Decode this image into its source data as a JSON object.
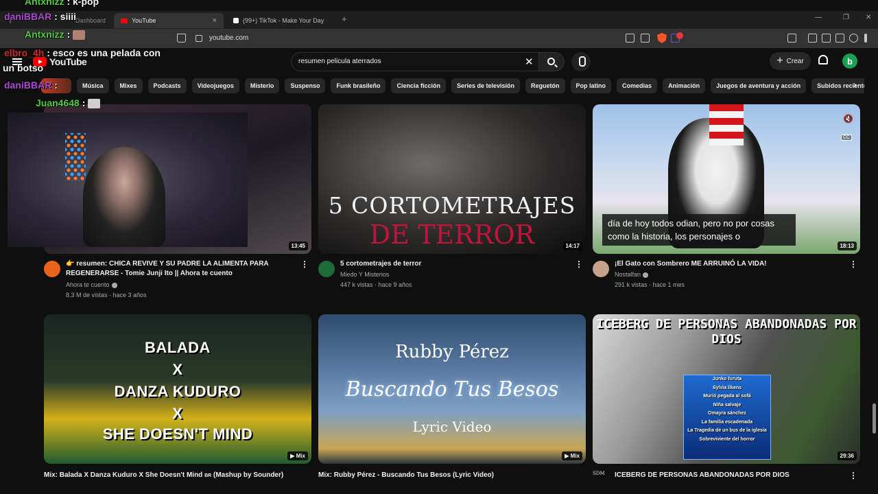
{
  "browser": {
    "tabs": [
      {
        "label": "Dashboard",
        "active": false
      },
      {
        "label": "YouTube",
        "active": true
      },
      {
        "label": "(99+) TikTok - Make Your Day",
        "active": false
      }
    ],
    "new_tab": "+",
    "url": "youtube.com"
  },
  "youtube": {
    "logo": "YouTube",
    "search_query": "resumen pelicula aterrados",
    "create_label": "Crear",
    "avatar_letter": "b",
    "chips": [
      "Música",
      "Mixes",
      "Podcasts",
      "Videojuegos",
      "Misterio",
      "Suspenso",
      "Funk brasileño",
      "Ciencia ficción",
      "Series de televisión",
      "Reguetón",
      "Pop latino",
      "Comedias",
      "Animación",
      "Juegos de aventura y acción",
      "Subidos recientemente"
    ]
  },
  "videos": [
    {
      "title_l1": "👉 resumen: CHICA REVIVE Y SU PADRE LA ALIMENTA PARA",
      "title_l2": "REGENERARSE - Tomie Junji Ito || Ahora te cuento",
      "channel": "Ahora te cuento",
      "stats": "8.3 M de vistas · hace 3 años",
      "duration": "13:45"
    },
    {
      "title_l1": "5 cortometrajes de terror",
      "channel": "Miedo Y Misterios",
      "stats": "447 k vistas · hace 9 años",
      "duration": "14:17",
      "thumb_line1": "5 CORTOMETRAJES",
      "thumb_line2": "DE TERROR"
    },
    {
      "title_l1": "¡El Gato con Sombrero ME ARRUINÓ LA VIDA!",
      "channel": "Nostalfan",
      "stats": "291 k vistas · hace 1 mes",
      "duration": "18:13",
      "caption": "día de hoy todos odian, pero no por cosas como la historia, los personajes o",
      "cc": "CC"
    },
    {
      "title_l1": "Mix: Balada X Danza Kuduro X She Doesn't Mind",
      "title_suffix": "BR",
      "title_l1b": "(Mashup by Sounder)",
      "badge": "Mix",
      "thumb_lines": [
        "BALADA",
        "X",
        "DANZA KUDURO",
        "X",
        "SHE DOESN'T MIND"
      ]
    },
    {
      "title_l1": "Mix: Rubby Pérez - Buscando Tus Besos (Lyric Video)",
      "badge": "Mix",
      "thumb_name": "Rubby Pérez",
      "thumb_song": "Buscando Tus Besos",
      "thumb_lyric": "Lyric Video"
    },
    {
      "title_l1": "ICEBERG DE PERSONAS ABANDONADAS POR DIOS",
      "duration": "29:36",
      "channel_icon_text": "SDM",
      "thumb_head": "ICEBERG DE PERSONAS ABANDONADAS POR DIOS",
      "iceberg_items": [
        "Junko furuta",
        "Sylvia likens",
        "Murió pegada al sofá",
        "Niña salvaje",
        "Omayra sánchez",
        "La familia escadenada",
        "La Tragedia de un bus de la iglesia",
        "Sobreviviente del horror"
      ]
    }
  ],
  "overlay_chat": [
    {
      "user": "Antxnizz",
      "msg": ": k-pop",
      "color": "#4fd13b"
    },
    {
      "user": "daniBBAR",
      "msg": ": siiii",
      "color": "#b04bd6"
    },
    {
      "user": "Antxnizz",
      "msg": ":",
      "color": "#4fd13b"
    },
    {
      "user": "elbro_4h",
      "msg": ": esco es una pelada con",
      "msg2": "un botso",
      "color": "#d12b2b"
    },
    {
      "user": "daniBBAR",
      "msg": ":",
      "color": "#b04bd6"
    },
    {
      "user": "Juan4648",
      "msg": ":",
      "color": "#4fd13b"
    }
  ],
  "colors": {
    "yt_red": "#ff0000",
    "bg": "#0f0f0f",
    "chip_bg": "#272727",
    "thumb_red_text": "#c2133c"
  },
  "icons": [
    "hamburger-icon",
    "search-icon",
    "mic-icon",
    "bell-icon",
    "kebab-icon",
    "verified-icon",
    "mute-icon",
    "brave-icon",
    "bookmark-icon"
  ]
}
